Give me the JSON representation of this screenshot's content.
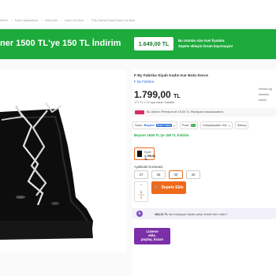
{
  "breadcrumb": [
    "Elbise",
    "Kadın Ayakkabılar",
    "Kadın Bot",
    "Kadın Kar Botu",
    "F By Fabrika Siyah Kadın Kar Botu"
  ],
  "banner": {
    "title": "ner 1500 TL'ye 150 TL İndirim",
    "price": "1.649,00 TL",
    "note_line1": "Bu ürünün size özel fiyatıdır.",
    "note_line2": "Sepete ekleyin fırsatı kaçırmayın!"
  },
  "product": {
    "title": "F By Fabrika Siyah Kadın Kar Botu Dorce",
    "brand": "F By Fabrika",
    "price": "1.799,00",
    "currency": "TL",
    "installment": "171 TL x 12 aya varan Taksitle",
    "premium_text": "Bu ürünün Premium ile 19,00 TL Hepsipara kazanacaksın.",
    "filters": {
      "seller_prefix": "Satıcı",
      "seller_name": "Boyner",
      "seller_tag": "Resmi Satıcı",
      "score_label": "Puan",
      "score_value": "8,1",
      "campaigns": "Kampanyaları Gör",
      "compare": "Satıcıy"
    },
    "promo": "Boyner 1500 TL'ye 150 TL İndirim",
    "swatch_color": "Siyah",
    "swatch_price": "1.799,00 TL",
    "size_label": "Ayakkabı Numarası:",
    "sizes": [
      "37",
      "38",
      "39",
      "40"
    ],
    "selected_size": "39",
    "quantity": "1",
    "quantity_unit": "adet",
    "cart_label": "Sepete Ekle",
    "hepsipara_amount": "104,11 TL",
    "hepsipara_text": "tam beşlayan fiyata sahip olmak ister misin?",
    "list_badge_line1": "Listene",
    "list_badge_line2": "ekle,",
    "list_badge_line3": "paylaş, kazan"
  },
  "side": {
    "line1": "Hemen öğ",
    "line2": "ürününü",
    "line3": "ürünle"
  },
  "colors": {
    "accent": "#ee6a1b",
    "banner_green": "#1dab3c",
    "link_blue": "#2a6fdb",
    "list_purple": "#7b2fa8"
  }
}
